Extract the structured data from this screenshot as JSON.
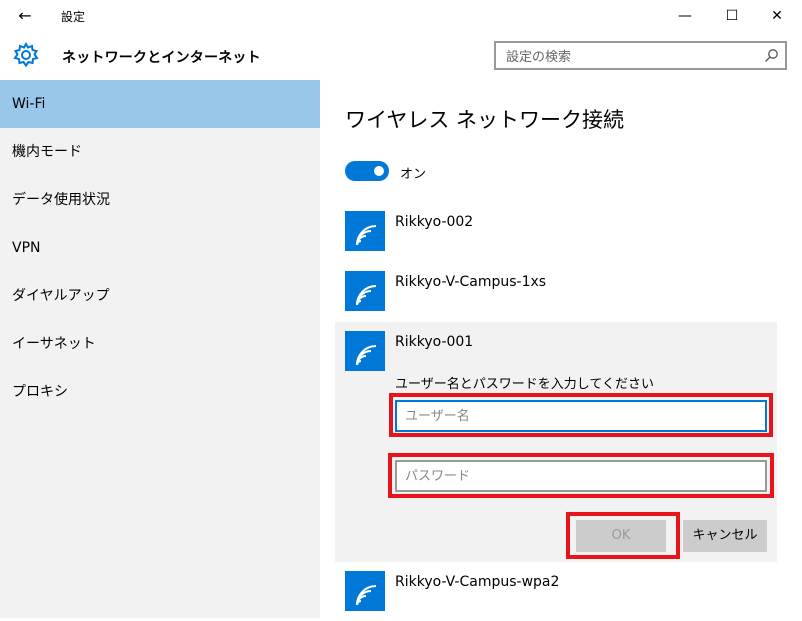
{
  "window": {
    "title": "設定",
    "back_glyph": "←",
    "minimize_glyph": "—",
    "maximize_glyph": "☐",
    "close_glyph": "✕"
  },
  "header": {
    "section_title": "ネットワークとインターネット",
    "search_placeholder": "設定の検索"
  },
  "sidebar": {
    "items": [
      {
        "label": "Wi-Fi",
        "active": true
      },
      {
        "label": "機内モード"
      },
      {
        "label": "データ使用状況"
      },
      {
        "label": "VPN"
      },
      {
        "label": "ダイヤルアップ"
      },
      {
        "label": "イーサネット"
      },
      {
        "label": "プロキシ"
      }
    ]
  },
  "main": {
    "title": "ワイヤレス ネットワーク接続",
    "toggle_label": "オン",
    "toggle_on": true,
    "networks": [
      {
        "name": "Rikkyo-002"
      },
      {
        "name": "Rikkyo-V-Campus-1xs"
      },
      {
        "name": "Rikkyo-001",
        "expanded": true
      },
      {
        "name": "Rikkyo-V-Campus-wpa2"
      }
    ],
    "credentials": {
      "prompt": "ユーザー名とパスワードを入力してください",
      "username_placeholder": "ユーザー名",
      "password_placeholder": "パスワード",
      "ok_label": "OK",
      "cancel_label": "キャンセル"
    }
  },
  "colors": {
    "accent": "#0078d7",
    "sidebar_active": "#99c7ea",
    "highlight": "#e8141c"
  }
}
